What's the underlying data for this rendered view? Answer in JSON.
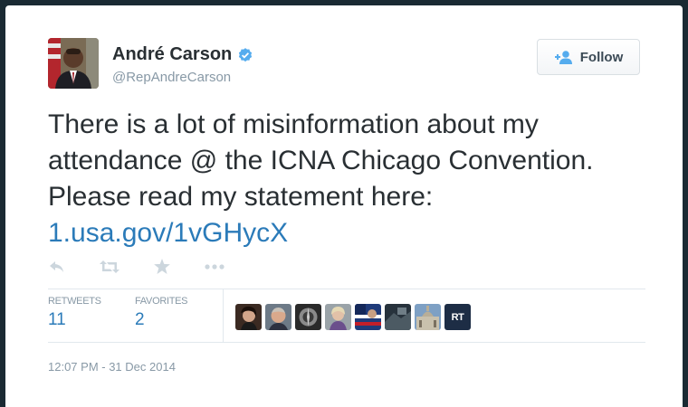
{
  "user": {
    "name": "André Carson",
    "handle": "@RepAndreCarson"
  },
  "follow_button": {
    "label": "Follow"
  },
  "tweet": {
    "text": "There is a lot of misinformation about my attendance @ the ICNA Chicago Convention. Please read my statement here: ",
    "link": "1.usa.gov/1vGHycX"
  },
  "actions": [
    "reply-icon",
    "retweet-icon",
    "favorite-icon",
    "more-icon"
  ],
  "stats": {
    "retweets_label": "RETWEETS",
    "retweets_value": "11",
    "favorites_label": "FAVORITES",
    "favorites_value": "2"
  },
  "favoriters": [
    {
      "icon": "avatar-photo"
    },
    {
      "icon": "avatar-photo"
    },
    {
      "icon": "avatar-photo"
    },
    {
      "icon": "avatar-photo"
    },
    {
      "icon": "avatar-photo"
    },
    {
      "icon": "avatar-photo"
    },
    {
      "icon": "avatar-photo"
    },
    {
      "text": "RT"
    }
  ],
  "timestamp": "12:07 PM - 31 Dec 2014",
  "colors": {
    "link": "#2b7bb9",
    "verified": "#55acee",
    "muted": "#8899a6",
    "text": "#292f33"
  }
}
